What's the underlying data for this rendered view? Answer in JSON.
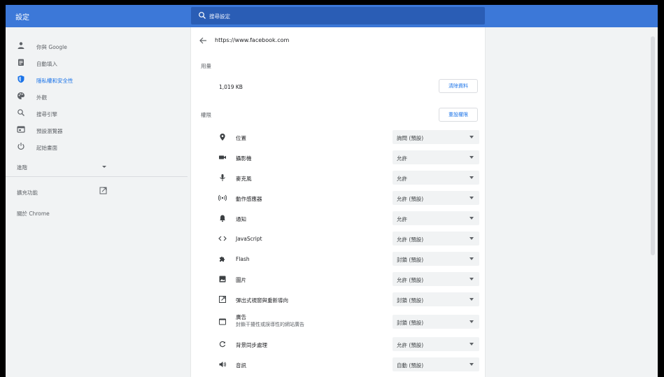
{
  "header": {
    "title": "設定",
    "search_placeholder": "搜尋設定"
  },
  "sidebar": {
    "items": [
      {
        "label": "你與 Google",
        "icon": "person-icon"
      },
      {
        "label": "自動填入",
        "icon": "clipboard-icon"
      },
      {
        "label": "隱私權和安全性",
        "icon": "shield-icon",
        "active": true
      },
      {
        "label": "外觀",
        "icon": "palette-icon"
      },
      {
        "label": "搜尋引擎",
        "icon": "search-icon"
      },
      {
        "label": "預設瀏覽器",
        "icon": "browser-icon"
      },
      {
        "label": "起始畫面",
        "icon": "power-icon"
      }
    ],
    "advanced": "進階",
    "extensions": "擴充功能",
    "about": "關於 Chrome"
  },
  "site": {
    "url": "https://www.facebook.com",
    "usage_title": "用量",
    "usage_amount": "1,019 KB",
    "clear_data": "清除資料",
    "permissions_title": "權限",
    "reset_permissions": "重設權限"
  },
  "permissions": [
    {
      "name": "位置",
      "value": "詢問 (預設)",
      "icon": "location-icon"
    },
    {
      "name": "攝影機",
      "value": "允許",
      "icon": "camera-icon"
    },
    {
      "name": "麥克風",
      "value": "允許",
      "icon": "mic-icon"
    },
    {
      "name": "動作感應器",
      "value": "允許 (預設)",
      "icon": "sensor-icon"
    },
    {
      "name": "通知",
      "value": "允許",
      "icon": "bell-icon"
    },
    {
      "name": "JavaScript",
      "value": "允許 (預設)",
      "icon": "code-icon"
    },
    {
      "name": "Flash",
      "value": "封鎖 (預設)",
      "icon": "puzzle-icon"
    },
    {
      "name": "圖片",
      "value": "允許 (預設)",
      "icon": "image-icon"
    },
    {
      "name": "彈出式視窗與重新導向",
      "value": "封鎖 (預設)",
      "icon": "popup-icon"
    },
    {
      "name": "廣告",
      "sub": "封鎖干擾性或誤導性的網站廣告",
      "value": "封鎖 (預設)",
      "icon": "ads-icon"
    },
    {
      "name": "背景同步處理",
      "value": "允許 (預設)",
      "icon": "sync-icon"
    },
    {
      "name": "音訊",
      "value": "自動 (預設)",
      "icon": "sound-icon"
    }
  ],
  "colors": {
    "header": "#3c78d8",
    "accent": "#1a73e8"
  }
}
